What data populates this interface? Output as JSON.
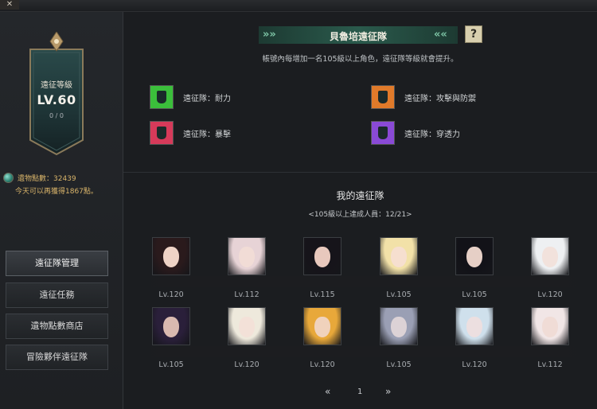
{
  "window": {
    "close_label": "✕"
  },
  "sidebar": {
    "level_title": "遠征等級",
    "level": "LV.60",
    "progress": "0 / 0",
    "points_text": "遺物點數：32439",
    "points_note": "今天可以再獲得1867點。",
    "nav": [
      {
        "label": "遠征隊管理",
        "active": true
      },
      {
        "label": "遠征任務",
        "active": false
      },
      {
        "label": "遺物點數商店",
        "active": false
      },
      {
        "label": "冒險夥伴遠征隊",
        "active": false
      }
    ]
  },
  "main": {
    "title": "貝魯培遠征隊",
    "help_label": "?",
    "subtitle": "帳號內每增加一名105級以上角色，遠征隊等級就會提升。",
    "stats": [
      {
        "label": "遠征隊：耐力",
        "icon": "green-armor-icon",
        "color": "#3bbf3b"
      },
      {
        "label": "遠征隊：攻擊與防禦",
        "icon": "orange-armor-icon",
        "color": "#e07a2a"
      },
      {
        "label": "遠征隊：暴擊",
        "icon": "red-armor-icon",
        "color": "#d63a5a"
      },
      {
        "label": "遠征隊：穿透力",
        "icon": "purple-armor-icon",
        "color": "#8a4ad6"
      }
    ],
    "party_title": "我的遠征隊",
    "party_count": "<105級以上達成人員：12/21>",
    "members": [
      {
        "level": "Lv.120",
        "hair": "#2a1a1c",
        "skin": "#efd3c6"
      },
      {
        "level": "Lv.112",
        "hair": "#e7d3d6",
        "skin": "#f1dcd6"
      },
      {
        "level": "Lv.115",
        "hair": "#16141a",
        "skin": "#e8c8bd"
      },
      {
        "level": "Lv.105",
        "hair": "#f2e1a8",
        "skin": "#f6dfcf"
      },
      {
        "level": "Lv.105",
        "hair": "#121218",
        "skin": "#e6cfc6"
      },
      {
        "level": "Lv.120",
        "hair": "#eef0f2",
        "skin": "#f2e2dc"
      },
      {
        "level": "Lv.105",
        "hair": "#2a1f3a",
        "skin": "#d9b9b0"
      },
      {
        "level": "Lv.120",
        "hair": "#eee9dc",
        "skin": "#f3e1d8"
      },
      {
        "level": "Lv.120",
        "hair": "#e8a83a",
        "skin": "#f0d2bc"
      },
      {
        "level": "Lv.105",
        "hair": "#9a9fb4",
        "skin": "#dcd2d6"
      },
      {
        "level": "Lv.120",
        "hair": "#cfe0ec",
        "skin": "#ecdfe0"
      },
      {
        "level": "Lv.112",
        "hair": "#f1e6e6",
        "skin": "#f0dcd6"
      }
    ],
    "pager": {
      "prev": "«",
      "page": "1",
      "next": "»"
    }
  }
}
